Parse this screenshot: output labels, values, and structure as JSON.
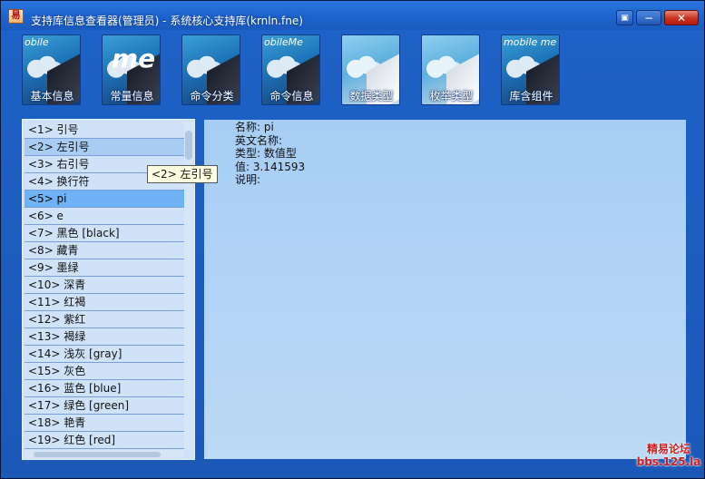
{
  "window": {
    "title": "支持库信息查看器(管理员) - 系统核心支持库(krnln.fne)",
    "app_icon_glyph": "易",
    "controls": {
      "menu_glyph": "▣",
      "minimize_glyph": "−",
      "close_glyph": "✕"
    }
  },
  "toolbar": {
    "buttons": [
      {
        "label": "基本信息",
        "brand": "obile",
        "style": "dark"
      },
      {
        "label": "常量信息",
        "brand": "me",
        "style": "dark"
      },
      {
        "label": "命令分类",
        "brand": "",
        "style": "dark"
      },
      {
        "label": "命令信息",
        "brand": "obileMe",
        "style": "dark"
      },
      {
        "label": "数据类型",
        "brand": "",
        "style": "light"
      },
      {
        "label": "枚举类型",
        "brand": "",
        "style": "light"
      },
      {
        "label": "库含组件",
        "brand": "mobile me",
        "style": "dark"
      }
    ]
  },
  "list": {
    "selected_index": 4,
    "hover_index": 1,
    "items": [
      "<1> 引号",
      "<2> 左引号",
      "<3> 右引号",
      "<4> 换行符",
      "<5> pi",
      "<6> e",
      "<7> 黑色 [black]",
      "<8> 藏青",
      "<9> 墨绿",
      "<10> 深青",
      "<11> 红褐",
      "<12> 紫红",
      "<13> 褐绿",
      "<14> 浅灰 [gray]",
      "<15> 灰色",
      "<16> 蓝色 [blue]",
      "<17> 绿色 [green]",
      "<18> 艳青",
      "<19> 红色 [red]"
    ]
  },
  "tooltip": {
    "text": "<2> 左引号"
  },
  "detail": {
    "lines": [
      "名称: pi",
      "英文名称:",
      "类型: 数值型",
      "值: 3.141593",
      "说明:"
    ]
  },
  "watermark": {
    "line1": "精易论坛",
    "line2": "bbs.125.la"
  },
  "colors": {
    "window_blue": "#1d5fc3",
    "detail_bg": "#a7cdf4",
    "list_selected": "#6fb2f5",
    "list_hover": "#a9ccf2",
    "close_red": "#c8321d"
  }
}
